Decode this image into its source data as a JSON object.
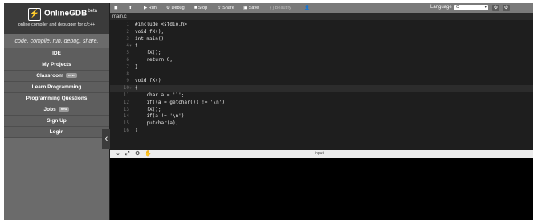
{
  "brand": {
    "logo_glyph": "⚡",
    "name": "OnlineGDB",
    "beta": "beta",
    "tagline": "online compiler and debugger for c/c++"
  },
  "slogan": "code. compile. run. debug. share.",
  "nav": [
    {
      "label": "IDE",
      "badge": ""
    },
    {
      "label": "My Projects",
      "badge": ""
    },
    {
      "label": "Classroom",
      "badge": "new"
    },
    {
      "label": "Learn Programming",
      "badge": ""
    },
    {
      "label": "Programming Questions",
      "badge": ""
    },
    {
      "label": "Jobs",
      "badge": "new"
    },
    {
      "label": "Sign Up",
      "badge": ""
    },
    {
      "label": "Login",
      "badge": ""
    }
  ],
  "toolbar": {
    "run": "Run",
    "debug": "Debug",
    "stop": "Stop",
    "share": "Share",
    "save": "Save",
    "beautify": "{ } Beautify",
    "language_label": "Language",
    "language_value": "C"
  },
  "tab_name": "main.c",
  "code_lines": [
    {
      "n": "1",
      "text": "#include <stdio.h>",
      "fold": ""
    },
    {
      "n": "2",
      "text": "void fX();",
      "fold": ""
    },
    {
      "n": "3",
      "text": "int main()",
      "fold": ""
    },
    {
      "n": "4",
      "text": "{",
      "fold": "▾"
    },
    {
      "n": "5",
      "text": "    fX();",
      "fold": ""
    },
    {
      "n": "6",
      "text": "    return 0;",
      "fold": ""
    },
    {
      "n": "7",
      "text": "}",
      "fold": ""
    },
    {
      "n": "8",
      "text": "",
      "fold": ""
    },
    {
      "n": "9",
      "text": "void fX()",
      "fold": ""
    },
    {
      "n": "10",
      "text": "{",
      "fold": "▾"
    },
    {
      "n": "11",
      "text": "    char a = '1';",
      "fold": ""
    },
    {
      "n": "12",
      "text": "    if((a = getchar()) != '\\n')",
      "fold": ""
    },
    {
      "n": "13",
      "text": "    fX();",
      "fold": ""
    },
    {
      "n": "14",
      "text": "    if(a != '\\n')",
      "fold": ""
    },
    {
      "n": "15",
      "text": "    putchar(a);",
      "fold": ""
    },
    {
      "n": "16",
      "text": "}",
      "fold": ""
    }
  ],
  "io": {
    "label": "input"
  },
  "colors": {
    "sidebar": "#6b6b6b",
    "brand_bg": "#3b3b3b",
    "editor_bg": "#1e1e1e",
    "toolbar": "#7a7a7a"
  }
}
